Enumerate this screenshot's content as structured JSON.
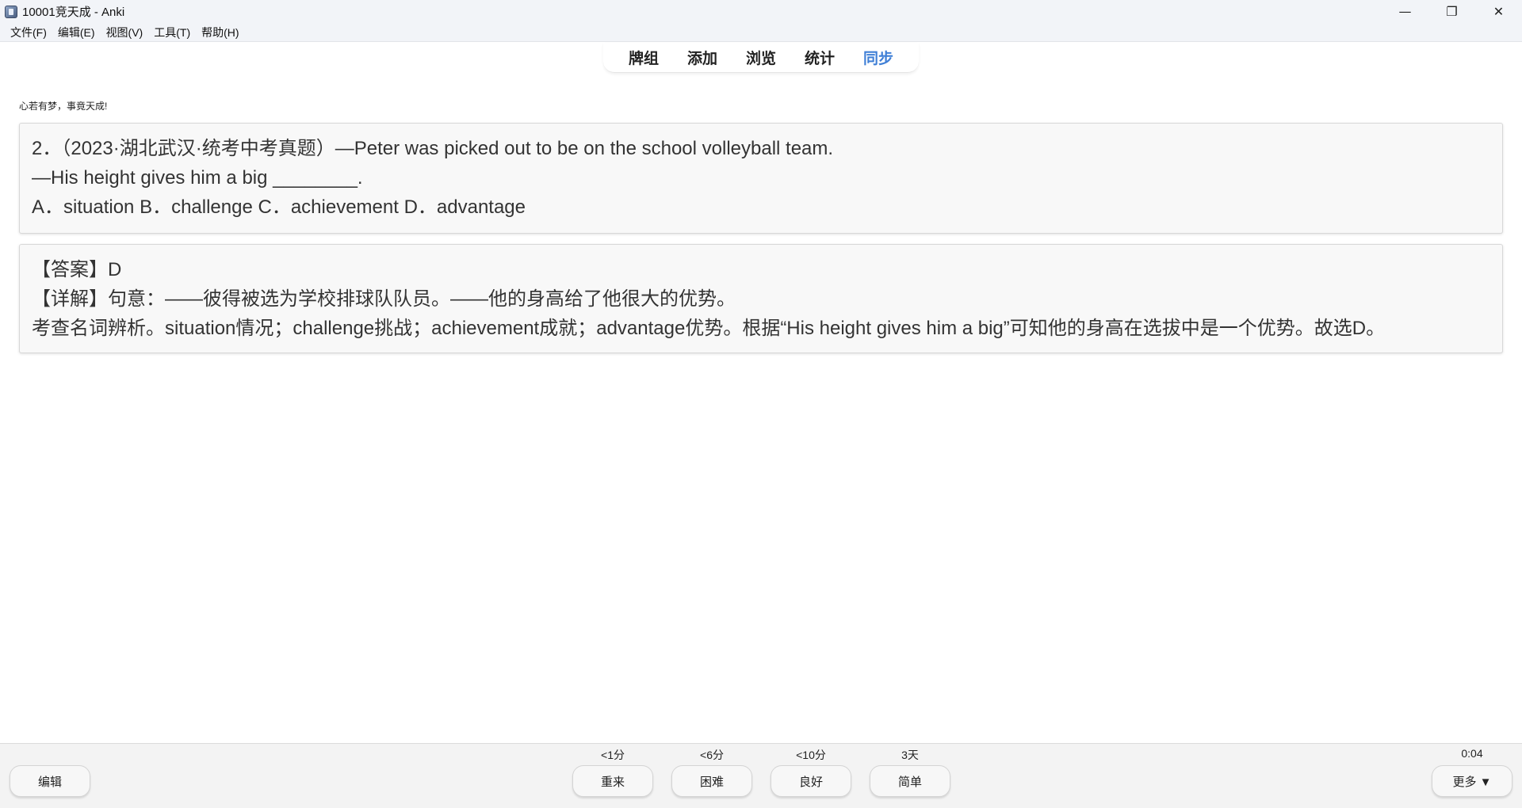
{
  "window": {
    "title": "10001竞天成 - Anki",
    "minimize_glyph": "—",
    "restore_glyph": "❐",
    "close_glyph": "✕"
  },
  "menu": [
    "文件(F)",
    "编辑(E)",
    "视图(V)",
    "工具(T)",
    "帮助(H)"
  ],
  "toolbar": {
    "links": [
      "牌组",
      "添加",
      "浏览",
      "统计",
      "同步"
    ],
    "active_link": "同步",
    "active_color": "#3f7fd6"
  },
  "deck_description": "心若有梦，事竟天成!",
  "question": {
    "lines": [
      "2．（2023·湖北武汉·统考中考真题）—Peter was picked out to be on the school volleyball team.",
      "—His height gives him a big ________.",
      "A．situation B．challenge C．achievement D．advantage"
    ]
  },
  "answer": {
    "lines": [
      "【答案】D",
      "【详解】句意：——彼得被选为学校排球队队员。——他的身高给了他很大的优势。",
      "考查名词辨析。situation情况；challenge挑战；achievement成就；advantage优势。根据“His height gives him a big”可知他的身高在选拔中是一个优势。故选D。"
    ]
  },
  "bottom_bar": {
    "edit_label": "编辑",
    "more_label": "更多 ▼",
    "timer": "0:04",
    "answer_buttons": [
      {
        "label": "重来",
        "interval": "<1分"
      },
      {
        "label": "困难",
        "interval": "<6分"
      },
      {
        "label": "良好",
        "interval": "<10分"
      },
      {
        "label": "简单",
        "interval": "3天"
      }
    ]
  }
}
